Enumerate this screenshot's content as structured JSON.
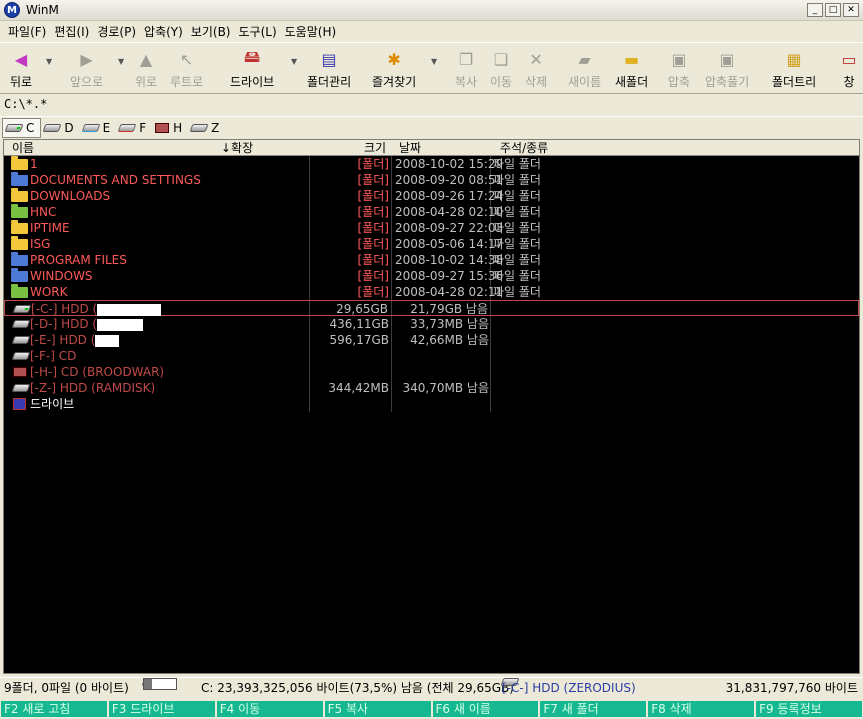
{
  "window": {
    "title": "WinM",
    "app_icon": "M"
  },
  "menu": [
    {
      "label": "파일(F)"
    },
    {
      "label": "편집(I)"
    },
    {
      "label": "경로(P)"
    },
    {
      "label": "압축(Y)"
    },
    {
      "label": "보기(B)"
    },
    {
      "label": "도구(L)"
    },
    {
      "label": "도움말(H)"
    }
  ],
  "toolbar": {
    "back": "뒤로",
    "forward": "앞으로",
    "up": "위로",
    "root": "루트로",
    "drive": "드라이브",
    "folder_manage": "폴더관리",
    "favorites": "즐겨찾기",
    "copy": "복사",
    "move": "이동",
    "delete": "삭제",
    "rename": "새이름",
    "new_folder": "새폴더",
    "compress": "압축",
    "extract": "압축풀기",
    "folder_tree": "폴더트리",
    "window": "창"
  },
  "path": "C:\\*.*",
  "drives": [
    {
      "label": "C",
      "icon": "hdd-icon"
    },
    {
      "label": "D",
      "icon": "hdd-icon"
    },
    {
      "label": "E",
      "icon": "hdd-icon"
    },
    {
      "label": "F",
      "icon": "cdrom-icon"
    },
    {
      "label": "H",
      "icon": "cdrom-icon"
    },
    {
      "label": "Z",
      "icon": "hdd-icon"
    }
  ],
  "columns": {
    "name": "이름",
    "ext": "↓확장",
    "size": "크기",
    "date": "날짜",
    "type": "주석/종류"
  },
  "files": [
    {
      "name": "1",
      "size": "[폴더]",
      "date": "2008-10-02 15:29",
      "type": "파일 폴더",
      "icon_color": "yellow"
    },
    {
      "name": "DOCUMENTS AND SETTINGS",
      "size": "[폴더]",
      "date": "2008-09-20 08:51",
      "type": "파일 폴더",
      "icon_color": "blue"
    },
    {
      "name": "DOWNLOADS",
      "size": "[폴더]",
      "date": "2008-09-26 17:24",
      "type": "파일 폴더",
      "icon_color": "yellow"
    },
    {
      "name": "HNC",
      "size": "[폴더]",
      "date": "2008-04-28 02:10",
      "type": "파일 폴더",
      "icon_color": "green"
    },
    {
      "name": "IPTIME",
      "size": "[폴더]",
      "date": "2008-09-27 22:03",
      "type": "파일 폴더",
      "icon_color": "yellow"
    },
    {
      "name": "ISG",
      "size": "[폴더]",
      "date": "2008-05-06 14:17",
      "type": "파일 폴더",
      "icon_color": "yellow"
    },
    {
      "name": "PROGRAM FILES",
      "size": "[폴더]",
      "date": "2008-10-02 14:38",
      "type": "파일 폴더",
      "icon_color": "blue"
    },
    {
      "name": "WINDOWS",
      "size": "[폴더]",
      "date": "2008-09-27 15:36",
      "type": "파일 폴더",
      "icon_color": "blue"
    },
    {
      "name": "WORK",
      "size": "[폴더]",
      "date": "2008-04-28 02:11",
      "type": "파일 폴더",
      "icon_color": "green"
    }
  ],
  "drive_rows": [
    {
      "name": "[-C-] HDD (",
      "size": "29,65GB",
      "free": "21,79GB 남음",
      "selected": true
    },
    {
      "name": "[-D-] HDD (",
      "size": "436,11GB",
      "free": "33,73MB 남음"
    },
    {
      "name": "[-E-] HDD (",
      "size": "596,17GB",
      "free": "42,66MB 남음"
    },
    {
      "name": "[-F-] CD",
      "size": "",
      "free": ""
    },
    {
      "name": "[-H-] CD (BROODWAR)",
      "size": "",
      "free": ""
    },
    {
      "name": "[-Z-] HDD (RAMDISK)",
      "size": "344,42MB",
      "free": "340,70MB 남음"
    }
  ],
  "drive_link": "드라이브",
  "status": {
    "summary": "9폴더, 0파일 (0 바이트)",
    "usage_fraction": 0.265,
    "free_text": "C: 23,393,325,056 바이트(73,5%) 남음 (전체 29,65GB)",
    "current_drive": "[-C-] HDD (ZERODIUS)",
    "total_bytes": "31,831,797,760 바이트"
  },
  "fkeys": [
    {
      "key": "F2",
      "label": "새로 고침"
    },
    {
      "key": "F3",
      "label": "드라이브"
    },
    {
      "key": "F4",
      "label": "이동"
    },
    {
      "key": "F5",
      "label": "복사"
    },
    {
      "key": "F6",
      "label": "새 이름"
    },
    {
      "key": "F7",
      "label": "새 폴더"
    },
    {
      "key": "F8",
      "label": "삭제"
    },
    {
      "key": "F9",
      "label": "등록정보"
    }
  ],
  "colors": {
    "folder_text": "#ff5a5a",
    "drive_text": "#c04a4a",
    "fkey_bg": "#15b890",
    "status_drive": "#2a3ea5"
  }
}
